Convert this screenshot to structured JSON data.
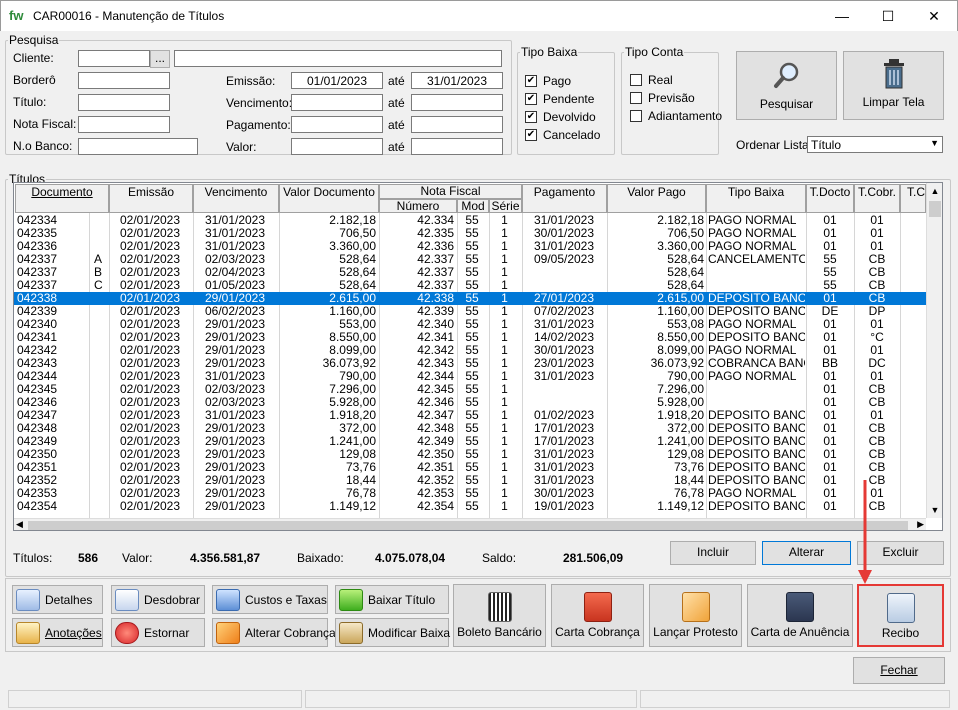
{
  "window": {
    "title": "CAR00016 - Manutenção de Títulos",
    "logo": "fw",
    "minimize": "—",
    "maximize": "☐",
    "close": "✕"
  },
  "pesquisa": {
    "legend": "Pesquisa",
    "cliente_label": "Cliente:",
    "cliente_btn": "...",
    "bordero_label": "Borderô",
    "titulo_label": "Título:",
    "nota_label": "Nota Fiscal:",
    "nbanco_label": "N.o Banco:",
    "emissao_label": "Emissão:",
    "emissao_de": "01/01/2023",
    "emissao_ate": "31/01/2023",
    "vencimento_label": "Vencimento:",
    "pagamento_label": "Pagamento:",
    "valor_label": "Valor:",
    "ate": "até"
  },
  "tipo_baixa": {
    "legend": "Tipo Baixa",
    "items": [
      {
        "label": "Pago",
        "checked": true
      },
      {
        "label": "Pendente",
        "checked": true
      },
      {
        "label": "Devolvido",
        "checked": true
      },
      {
        "label": "Cancelado",
        "checked": true
      }
    ]
  },
  "tipo_conta": {
    "legend": "Tipo Conta",
    "items": [
      {
        "label": "Real",
        "checked": false
      },
      {
        "label": "Previsão",
        "checked": false
      },
      {
        "label": "Adiantamento",
        "checked": false
      }
    ]
  },
  "actions": {
    "pesquisar": "Pesquisar",
    "limpar": "Limpar Tela",
    "ordenar_label": "Ordenar Lista:",
    "ordenar_value": "Título"
  },
  "titulos": {
    "legend": "Títulos",
    "headers": [
      "Documento",
      "Emissão",
      "Vencimento",
      "Valor Documento",
      "Nota Fiscal",
      "Número",
      "Mod",
      "Série",
      "Pagamento",
      "Valor Pago",
      "Tipo Baixa",
      "T.Docto",
      "T.Cobr.",
      "T.C"
    ],
    "rows": [
      [
        "042334",
        "",
        "02/01/2023",
        "31/01/2023",
        "2.182,18",
        "42.334",
        "55",
        "1",
        "31/01/2023",
        "2.182,18",
        "PAGO NORMAL",
        "01",
        "01"
      ],
      [
        "042335",
        "",
        "02/01/2023",
        "31/01/2023",
        "706,50",
        "42.335",
        "55",
        "1",
        "30/01/2023",
        "706,50",
        "PAGO NORMAL",
        "01",
        "01"
      ],
      [
        "042336",
        "",
        "02/01/2023",
        "31/01/2023",
        "3.360,00",
        "42.336",
        "55",
        "1",
        "31/01/2023",
        "3.360,00",
        "PAGO NORMAL",
        "01",
        "01"
      ],
      [
        "042337",
        "A",
        "02/01/2023",
        "02/03/2023",
        "528,64",
        "42.337",
        "55",
        "1",
        "09/05/2023",
        "528,64",
        "CANCELAMENTO",
        "55",
        "CB"
      ],
      [
        "042337",
        "B",
        "02/01/2023",
        "02/04/2023",
        "528,64",
        "42.337",
        "55",
        "1",
        "",
        "528,64",
        "",
        "55",
        "CB"
      ],
      [
        "042337",
        "C",
        "02/01/2023",
        "01/05/2023",
        "528,64",
        "42.337",
        "55",
        "1",
        "",
        "528,64",
        "",
        "55",
        "CB"
      ],
      [
        "042338",
        "",
        "02/01/2023",
        "29/01/2023",
        "2.615,00",
        "42.338",
        "55",
        "1",
        "27/01/2023",
        "2.615,00",
        "DEPOSITO BANCA",
        "01",
        "CB"
      ],
      [
        "042339",
        "",
        "02/01/2023",
        "06/02/2023",
        "1.160,00",
        "42.339",
        "55",
        "1",
        "07/02/2023",
        "1.160,00",
        "DEPOSITO BANCA",
        "DE",
        "DP"
      ],
      [
        "042340",
        "",
        "02/01/2023",
        "29/01/2023",
        "553,00",
        "42.340",
        "55",
        "1",
        "31/01/2023",
        "553,08",
        "PAGO NORMAL",
        "01",
        "01"
      ],
      [
        "042341",
        "",
        "02/01/2023",
        "29/01/2023",
        "8.550,00",
        "42.341",
        "55",
        "1",
        "14/02/2023",
        "8.550,00",
        "DEPOSITO BANCA",
        "01",
        "°C"
      ],
      [
        "042342",
        "",
        "02/01/2023",
        "29/01/2023",
        "8.099,00",
        "42.342",
        "55",
        "1",
        "30/01/2023",
        "8.099,00",
        "PAGO NORMAL",
        "01",
        "01"
      ],
      [
        "042343",
        "",
        "02/01/2023",
        "29/01/2023",
        "36.073,92",
        "42.343",
        "55",
        "1",
        "23/01/2023",
        "36.073,92",
        "COBRANCA BANCA",
        "BB",
        "DC"
      ],
      [
        "042344",
        "",
        "02/01/2023",
        "31/01/2023",
        "790,00",
        "42.344",
        "55",
        "1",
        "31/01/2023",
        "790,00",
        "PAGO NORMAL",
        "01",
        "01"
      ],
      [
        "042345",
        "",
        "02/01/2023",
        "02/03/2023",
        "7.296,00",
        "42.345",
        "55",
        "1",
        "",
        "7.296,00",
        "",
        "01",
        "CB"
      ],
      [
        "042346",
        "",
        "02/01/2023",
        "02/03/2023",
        "5.928,00",
        "42.346",
        "55",
        "1",
        "",
        "5.928,00",
        "",
        "01",
        "CB"
      ],
      [
        "042347",
        "",
        "02/01/2023",
        "31/01/2023",
        "1.918,20",
        "42.347",
        "55",
        "1",
        "01/02/2023",
        "1.918,20",
        "DEPOSITO BANCA",
        "01",
        "01"
      ],
      [
        "042348",
        "",
        "02/01/2023",
        "29/01/2023",
        "372,00",
        "42.348",
        "55",
        "1",
        "17/01/2023",
        "372,00",
        "DEPOSITO BANCA",
        "01",
        "CB"
      ],
      [
        "042349",
        "",
        "02/01/2023",
        "29/01/2023",
        "1.241,00",
        "42.349",
        "55",
        "1",
        "17/01/2023",
        "1.241,00",
        "DEPOSITO BANCA",
        "01",
        "CB"
      ],
      [
        "042350",
        "",
        "02/01/2023",
        "29/01/2023",
        "129,08",
        "42.350",
        "55",
        "1",
        "31/01/2023",
        "129,08",
        "DEPOSITO BANCA",
        "01",
        "CB"
      ],
      [
        "042351",
        "",
        "02/01/2023",
        "29/01/2023",
        "73,76",
        "42.351",
        "55",
        "1",
        "31/01/2023",
        "73,76",
        "DEPOSITO BANCA",
        "01",
        "CB"
      ],
      [
        "042352",
        "",
        "02/01/2023",
        "29/01/2023",
        "18,44",
        "42.352",
        "55",
        "1",
        "31/01/2023",
        "18,44",
        "DEPOSITO BANCA",
        "01",
        "CB"
      ],
      [
        "042353",
        "",
        "02/01/2023",
        "29/01/2023",
        "76,78",
        "42.353",
        "55",
        "1",
        "30/01/2023",
        "76,78",
        "PAGO NORMAL",
        "01",
        "01"
      ],
      [
        "042354",
        "",
        "02/01/2023",
        "29/01/2023",
        "1.149,12",
        "42.354",
        "55",
        "1",
        "19/01/2023",
        "1.149,12",
        "DEPOSITO BANCA",
        "01",
        "CB"
      ]
    ],
    "selected_row": 6
  },
  "totals": {
    "titulos_label": "Títulos:",
    "titulos": "586",
    "valor_label": "Valor:",
    "valor": "4.356.581,87",
    "baixado_label": "Baixado:",
    "baixado": "4.075.078,04",
    "saldo_label": "Saldo:",
    "saldo": "281.506,09"
  },
  "row_buttons": {
    "incluir": "Incluir",
    "alterar": "Alterar",
    "excluir": "Excluir"
  },
  "tools": {
    "detalhes": "Detalhes",
    "desdobrar": "Desdobrar",
    "custos": "Custos e Taxas",
    "baixar": "Baixar Título",
    "anotacoes": "Anotações",
    "estornar": "Estornar",
    "alterar_cobranca": "Alterar Cobrança",
    "modificar_baixa": "Modificar Baixa"
  },
  "big_tools": {
    "boleto": "Boleto Bancário",
    "carta_cobranca": "Carta Cobrança",
    "protesto": "Lançar Protesto",
    "anuencia": "Carta de Anuência",
    "recibo": "Recibo"
  },
  "fechar": "Fechar",
  "colors": {
    "selection": "#0078d7",
    "highlight": "#e53935"
  }
}
